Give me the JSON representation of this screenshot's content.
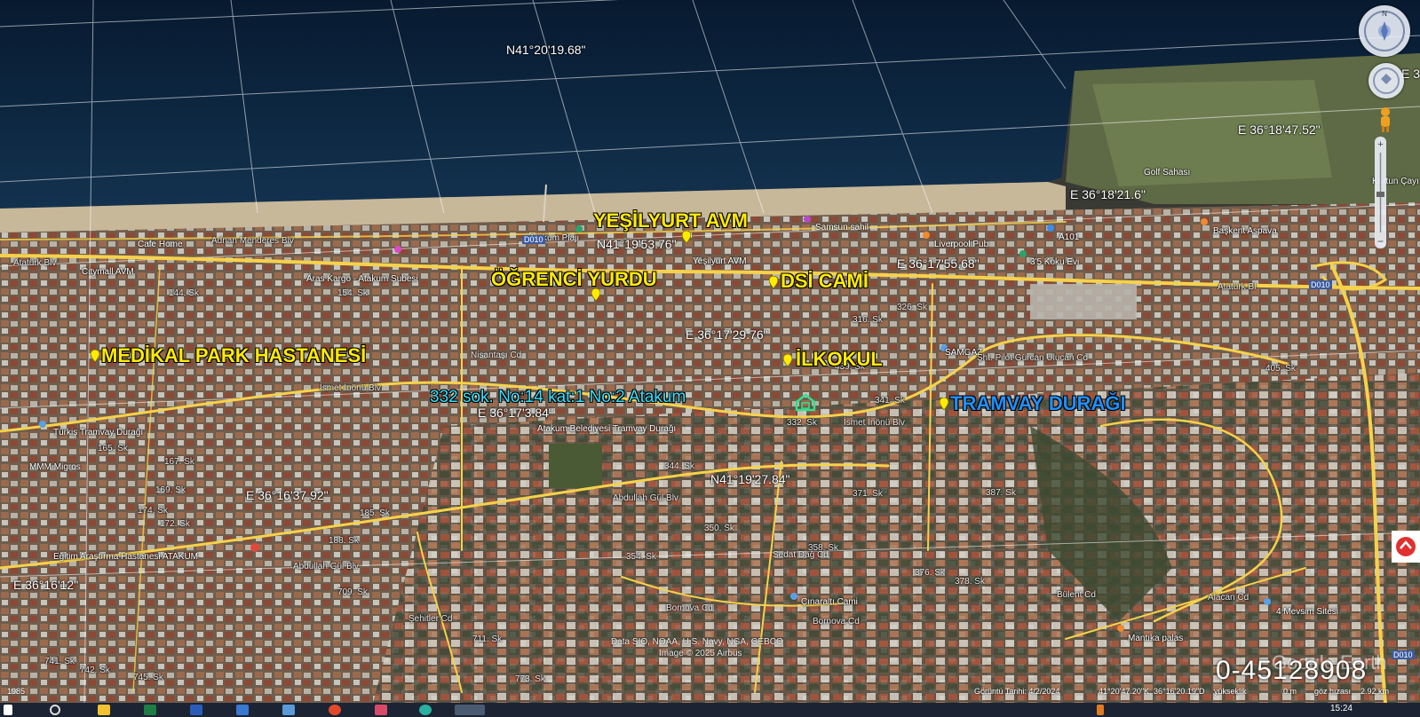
{
  "map": {
    "coordinates": [
      {
        "id": "n1",
        "text": "N41°20'19.68\""
      },
      {
        "id": "e1",
        "text": "E 36°18'47.52\""
      },
      {
        "id": "e2",
        "text": "E 36°18'21.6\""
      },
      {
        "id": "n2",
        "text": "N41°19'53.76\""
      },
      {
        "id": "e3",
        "text": "E 36°17'55.68\""
      },
      {
        "id": "e4",
        "text": "E 36°17'29.76\""
      },
      {
        "id": "e5",
        "text": "E 36°17'3.84\""
      },
      {
        "id": "n3",
        "text": "N41°19'27.84\""
      },
      {
        "id": "e6",
        "text": "E 36°16'37.92\""
      },
      {
        "id": "e7",
        "text": "E 36°16'12\""
      },
      {
        "id": "e8",
        "text": "E 3"
      }
    ],
    "placemarks": [
      {
        "id": "yesilyurt",
        "label": "YEŞİLYURT AVM"
      },
      {
        "id": "ogrenci",
        "label": "ÖĞRENCİ YURDU"
      },
      {
        "id": "dsi",
        "label": "DSİ CAMİ"
      },
      {
        "id": "medikal",
        "label": "MEDİKAL PARK HASTANESİ"
      },
      {
        "id": "ilkokul",
        "label": "İLKOKUL"
      },
      {
        "id": "tramvay",
        "label": "TRAMVAY DURAĞI"
      }
    ],
    "address": "332 sok. No:14 kat:1 No:2 Atakum",
    "streets": [
      "Adnan Menderes Blv",
      "Atatürk Blv",
      "Atatürk Bl",
      "İsmet İnönü Blv",
      "İsmet İnönü Blv",
      "Abdullah Gül Blv",
      "Abdullah Gül Blv",
      "Bornova Cd",
      "Bornova Cd",
      "Şht. Pilot Gürcan Ulucan Cd",
      "144. Sk",
      "154. Sk",
      "165. Sk",
      "167. Sk",
      "169. Sk",
      "174. Sk",
      "172. Sk",
      "185. Sk",
      "188. Sk",
      "709. Sk",
      "711. Sk",
      "741. Sk",
      "742. Sk",
      "745. Sk",
      "773. Sk",
      "316. Sk",
      "326. Sk",
      "341. Sk",
      "332. Sk",
      "344. Sk",
      "350. Sk",
      "354. Sk",
      "358. Sk",
      "371. Sk",
      "376. Sk",
      "378. Sk",
      "387. Sk",
      "405. Sk",
      "439. Sk",
      "Alacan Cd",
      "Nisantaşı Cd",
      "Şehitler Cd",
      "Sedat Dağ Cd",
      "Bülent Cd"
    ],
    "pois": [
      "Cafe Home",
      "Citymall AVM",
      "Aras Kargo - Atakum Şubesi",
      "Atakum Plajı",
      "Yeşilyurt AVM",
      "Samsun sahil",
      "Liverpool Pub",
      "A101",
      "3'5 Koku Evi",
      "Başkent Aspava",
      "Golf Sahası",
      "Kurtun Çayı",
      "SAMGAZ",
      "Türkiş Tramvay Durağı",
      "MMM Migros",
      "Atakum Belediyesi Tramvay Durağı",
      "Eğitim Araştırma Hastanesi ATAKUM",
      "Çınaraltı Cami",
      "Mantıka palas",
      "4 Mevsim Sitesi"
    ],
    "road_shield": "D010",
    "attribution": [
      "Data SIO, NOAA, U.S. Navy, NGA, GEBCO",
      "Image © 2025 Airbus"
    ],
    "scale_overlay": "0-45128908",
    "watermark": "Google Earth",
    "status": {
      "date": "Görüntü Tarihi: 4/2/2024",
      "lat": "41°20'47.20\"K",
      "lon": "36°16'20.19\"D",
      "elev_label": "yükseklik",
      "elev": "0 m",
      "eye": "göz hızası",
      "alt": "2.92 km",
      "year": "1985"
    }
  },
  "taskbar": {
    "clock": "15:24"
  },
  "colors": {
    "sea": "#0f2a45",
    "sand": "#c7b89a",
    "urban": "#6b5a4a",
    "road": "#f5d24a",
    "grid": "#ffffff",
    "placemark": "#ffeb00",
    "address": "#35e0ff",
    "tramvay": "#1e90ff",
    "taskbar": "#1c2433"
  },
  "icons": [
    "navigation-compass-icon",
    "look-joystick-icon",
    "street-view-pegman-icon",
    "zoom-slider-icon",
    "home-icon",
    "placemark-pin-icon"
  ]
}
